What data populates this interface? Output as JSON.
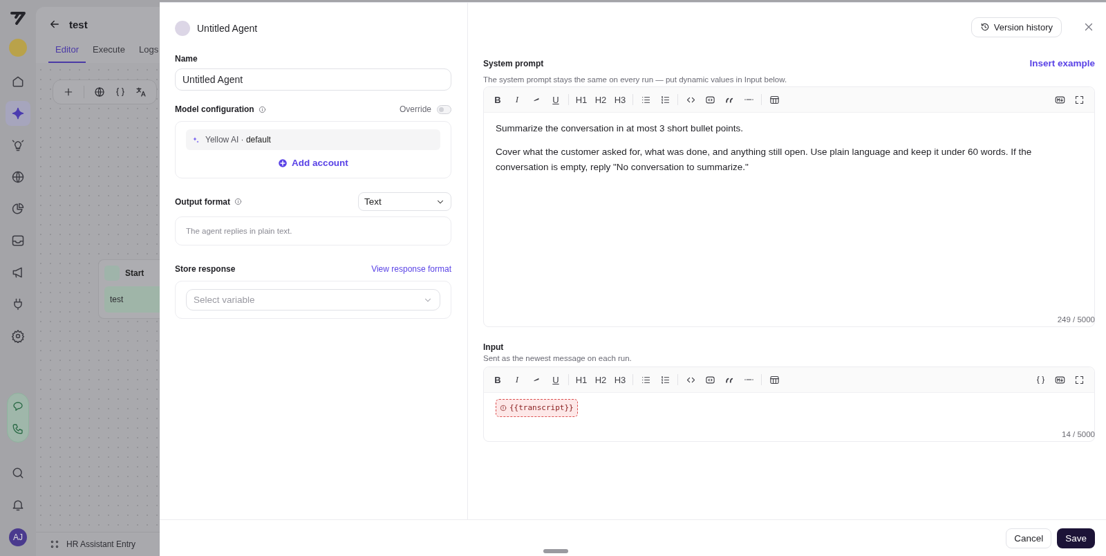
{
  "background_app": {
    "sidebar": {
      "nav_items": [
        {
          "kind": "home",
          "selected": false
        },
        {
          "kind": "sparkle",
          "selected": true
        },
        {
          "kind": "bulb",
          "selected": false
        },
        {
          "kind": "globe",
          "selected": false
        },
        {
          "kind": "pie",
          "selected": false
        },
        {
          "kind": "inbox",
          "selected": false
        },
        {
          "kind": "megaphone",
          "selected": false
        },
        {
          "kind": "plug",
          "selected": false
        },
        {
          "kind": "gear",
          "selected": false
        }
      ],
      "user_initials": "AJ"
    },
    "title": "test",
    "tabs": [
      {
        "label": "Editor",
        "selected": true
      },
      {
        "label": "Execute",
        "selected": false
      },
      {
        "label": "Logs",
        "selected": false
      }
    ],
    "node": {
      "title": "Start",
      "item": "test"
    },
    "footer": "HR Assistant Entry"
  },
  "drawer": {
    "agent_name": "Untitled Agent",
    "version_history": "Version history",
    "name": {
      "label": "Name",
      "value": "Untitled Agent"
    },
    "model_configuration": {
      "label": "Model configuration",
      "override_label": "Override",
      "override_on": false,
      "model": "Yellow AI · **default**",
      "add_account": "Add account"
    },
    "output_format": {
      "label": "Output format",
      "value": "Text",
      "description": "The agent replies in plain text."
    },
    "store_response": {
      "label": "Store response",
      "link": "View response format",
      "placeholder": "Select variable"
    },
    "system_prompt": {
      "label": "System prompt",
      "action": "Insert example",
      "hint": "The system prompt stays the same on every run — put dynamic values in Input below.",
      "toolbar": {
        "groups": [
          [
            {
              "kind": "bold",
              "label": "B"
            },
            {
              "kind": "italic",
              "label": "I"
            },
            {
              "kind": "highlight"
            },
            {
              "kind": "underline",
              "label": "U"
            }
          ],
          [
            {
              "kind": "heading",
              "label": "H1"
            },
            {
              "kind": "heading",
              "label": "H2"
            },
            {
              "kind": "heading",
              "label": "H3"
            }
          ],
          [
            {
              "kind": "bullets"
            },
            {
              "kind": "numbers"
            }
          ],
          [
            {
              "kind": "code"
            },
            {
              "kind": "codeblock"
            },
            {
              "kind": "quote"
            },
            {
              "kind": "rule"
            }
          ],
          [
            {
              "kind": "table"
            }
          ]
        ],
        "right": [
          {
            "kind": "markdown"
          },
          {
            "kind": "fullscreen"
          }
        ]
      },
      "paragraphs": [
        "Summarize the conversation in at most 3 short bullet points.",
        "Cover what the customer asked for, what was done, and anything still open. Use plain language and keep it under 60 words. If the conversation is empty, reply \"No conversation to summarize.\""
      ],
      "counter": "249 / 5000"
    },
    "input": {
      "label": "Input",
      "hint": "Sent as the newest message on each run.",
      "toolbar": {
        "groups": [
          [
            {
              "kind": "bold",
              "label": "B"
            },
            {
              "kind": "italic",
              "label": "I"
            },
            {
              "kind": "highlight"
            },
            {
              "kind": "underline",
              "label": "U"
            }
          ],
          [
            {
              "kind": "heading",
              "label": "H1"
            },
            {
              "kind": "heading",
              "label": "H2"
            },
            {
              "kind": "heading",
              "label": "H3"
            }
          ],
          [
            {
              "kind": "bullets"
            },
            {
              "kind": "numbers"
            }
          ],
          [
            {
              "kind": "code"
            },
            {
              "kind": "codeblock"
            },
            {
              "kind": "quote"
            },
            {
              "kind": "rule"
            }
          ],
          [
            {
              "kind": "table"
            }
          ]
        ],
        "right": [
          {
            "kind": "braces"
          },
          {
            "kind": "markdown"
          },
          {
            "kind": "fullscreen"
          }
        ]
      },
      "variable": {
        "text": "{{transcript}}",
        "invalid": true
      },
      "counter": "14 / 5000"
    },
    "cancel": "Cancel",
    "save": "Save"
  }
}
